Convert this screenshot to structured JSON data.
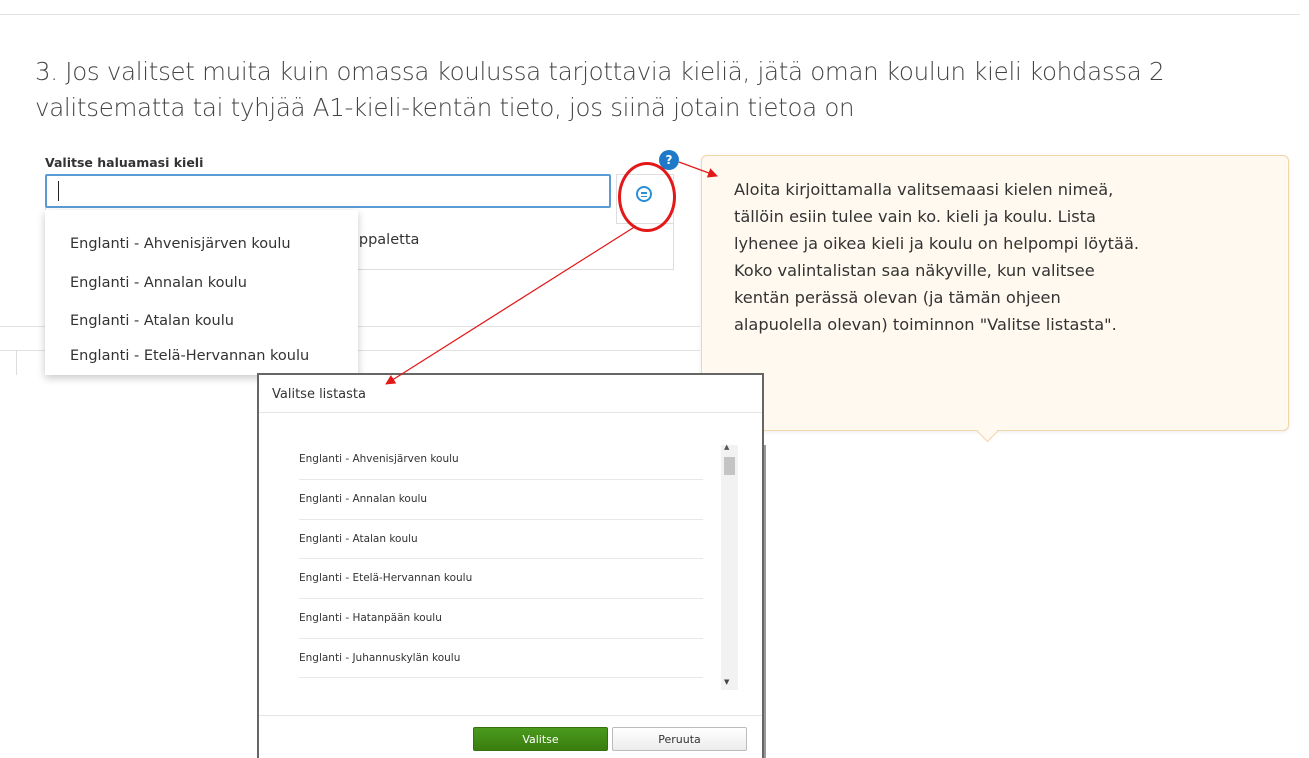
{
  "question": {
    "title_line1": "3. Jos valitset muita kuin omassa koulussa tarjottavia kieliä, jätä oman koulun kieli kohdassa 2",
    "title_line2": "valitsematta tai tyhjää A1-kieli-kentän tieto, jos siinä jotain tietoa on"
  },
  "field": {
    "label": "Valitse haluamasi kieli",
    "value": "",
    "help_icon": "?",
    "behind_text": "appaletta"
  },
  "dropdown": {
    "items": [
      "Englanti - Ahvenisjärven koulu",
      "Englanti - Annalan koulu",
      "Englanti - Atalan koulu",
      "Englanti - Etelä-Hervannan koulu"
    ]
  },
  "tooltip": {
    "text": "Aloita kirjoittamalla valitsemaasi kielen nimeä,\ntällöin esiin tulee vain ko. kieli ja koulu. Lista\nlyhenee ja oikea kieli ja koulu on helpompi löytää.\nKoko valintalistan saa näkyville, kun valitsee\nkentän perässä olevan (ja tämän ohjeen\nalapuolella olevan) toiminnon \"Valitse listasta\"."
  },
  "modal": {
    "title": "Valitse listasta",
    "items": [
      "Englanti - Ahvenisjärven koulu",
      "Englanti - Annalan koulu",
      "Englanti - Atalan koulu",
      "Englanti - Etelä-Hervannan koulu",
      "Englanti - Hatanpään koulu",
      "Englanti - Juhannuskylän koulu"
    ],
    "select_label": "Valitse",
    "cancel_label": "Peruuta"
  },
  "colors": {
    "accent_blue": "#2a8ed9",
    "annotation_red": "#e31919",
    "select_green": "#3a7d10",
    "tooltip_bg": "#fff9ef"
  },
  "icons": {
    "help": "help-icon",
    "list": "list-select-icon"
  }
}
